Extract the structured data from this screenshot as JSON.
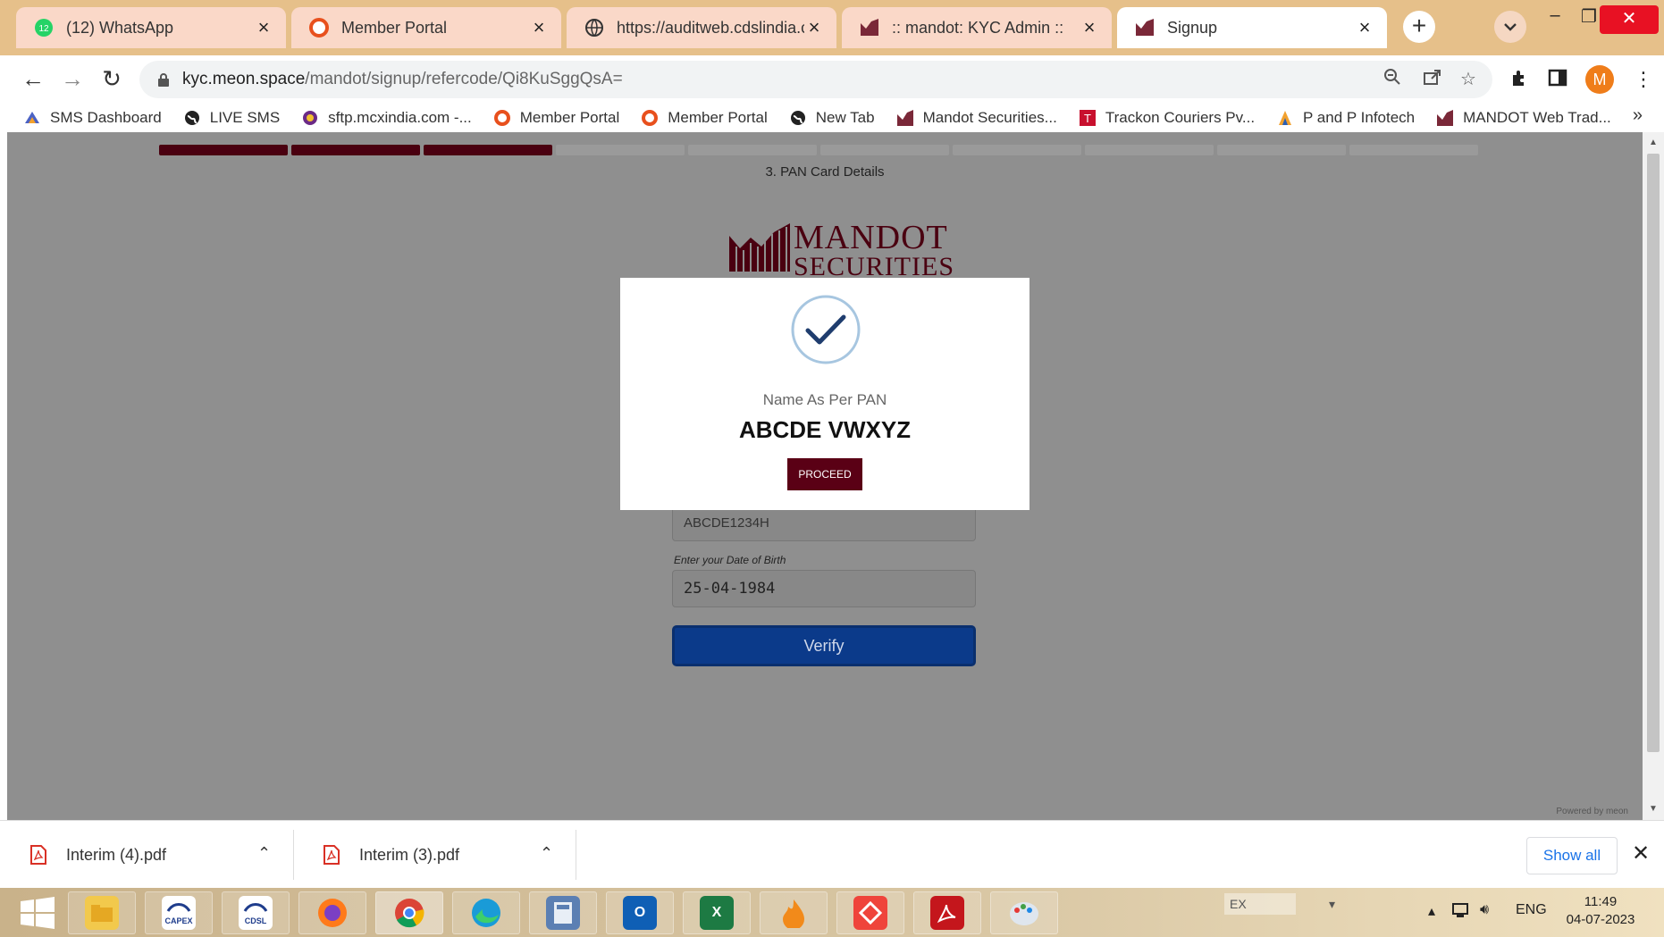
{
  "tabs": [
    {
      "title": "(12) WhatsApp",
      "badge": "12"
    },
    {
      "title": "Member Portal"
    },
    {
      "title": "https://auditweb.cdslindia.com"
    },
    {
      "title": ":: mandot: KYC Admin ::"
    },
    {
      "title": "Signup"
    }
  ],
  "omnibox": {
    "host": "kyc.meon.space",
    "path": "/mandot/signup/refercode/Qi8KuSggQsA="
  },
  "profile_initial": "M",
  "bookmarks": [
    {
      "label": "SMS Dashboard"
    },
    {
      "label": "LIVE SMS"
    },
    {
      "label": "sftp.mcxindia.com -..."
    },
    {
      "label": "Member Portal"
    },
    {
      "label": "Member Portal"
    },
    {
      "label": "New Tab"
    },
    {
      "label": "Mandot Securities..."
    },
    {
      "label": "Trackon Couriers Pv..."
    },
    {
      "label": "P and P Infotech"
    },
    {
      "label": "MANDOT Web Trad..."
    }
  ],
  "bookmarks_more": "»",
  "page": {
    "steps_total": 10,
    "steps_done": 3,
    "step_title": "3. PAN Card Details",
    "logo_line1": "MANDOT",
    "logo_line2": "SECURITIES",
    "pan_value": "ABCDE1234H",
    "dob_label": "Enter your Date of Birth",
    "dob_value": "25-04-1984",
    "verify_label": "Verify",
    "powered_by": "Powered by meon"
  },
  "modal": {
    "label": "Name As Per PAN",
    "name": "ABCDE VWXYZ",
    "button": "PROCEED"
  },
  "downloads": [
    {
      "file": "Interim (4).pdf"
    },
    {
      "file": "Interim (3).pdf"
    }
  ],
  "show_all": "Show all",
  "taskbar": {
    "capex_label": "CAPEX",
    "cdsl_label": "CDSL",
    "ex_label": "EX",
    "lang": "ENG",
    "time": "11:49",
    "date": "04-07-2023"
  },
  "colors": {
    "brand_maroon": "#4a0010",
    "verify_blue": "#0b3a8a",
    "tab_strip": "#e6c08a"
  }
}
